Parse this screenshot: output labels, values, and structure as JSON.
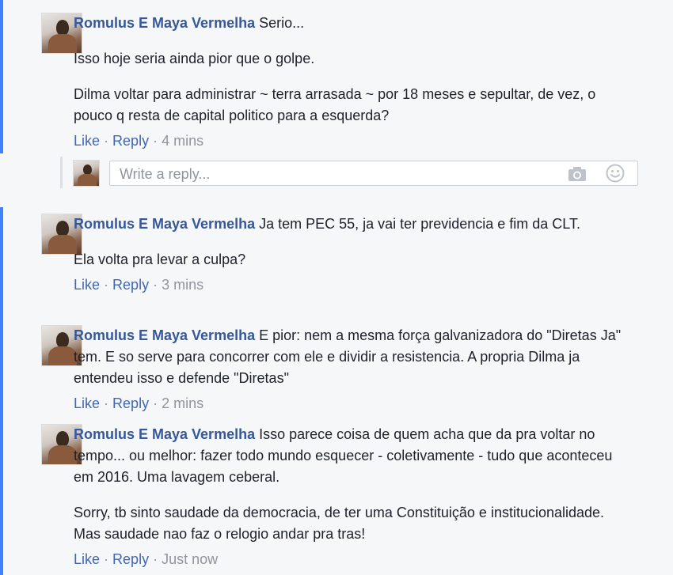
{
  "comments": [
    {
      "author": "Romulus E Maya Vermelha",
      "paragraphs": [
        "Serio...",
        "Isso hoje seria ainda pior que o golpe.",
        "Dilma voltar para administrar ~ terra arrasada ~ por 18 meses e sepultar, de vez, o pouco q resta de capital politico para a esquerda?"
      ],
      "like": "Like",
      "reply": "Reply",
      "time": "4 mins"
    },
    {
      "author": "Romulus E Maya Vermelha",
      "paragraphs": [
        "Ja tem PEC 55, ja vai ter previdencia e fim da CLT.",
        "Ela volta pra levar a culpa?"
      ],
      "like": "Like",
      "reply": "Reply",
      "time": "3 mins"
    },
    {
      "author": "Romulus E Maya Vermelha",
      "paragraphs": [
        "E pior: nem a mesma força galvanizadora do \"Diretas Ja\" tem. E so serve para concorrer com ele e dividir a resistencia. A propria Dilma ja entendeu isso e defende \"Diretas\""
      ],
      "like": "Like",
      "reply": "Reply",
      "time": "2 mins"
    },
    {
      "author": "Romulus E Maya Vermelha",
      "paragraphs": [
        "Isso parece coisa de quem acha que da pra voltar no tempo... ou melhor: fazer todo mundo esquecer - coletivamente - tudo que aconteceu em 2016. Uma lavagem ceberal.",
        "Sorry, tb sinto saudade da democracia, de ter uma Constituição e institucionalidade. Mas saudade nao faz o relogio andar pra tras!"
      ],
      "like": "Like",
      "reply": "Reply",
      "time": "Just now"
    }
  ],
  "reply_box": {
    "placeholder": "Write a reply...",
    "icons": [
      "camera-icon",
      "smiley-icon"
    ]
  },
  "colors": {
    "author": "#365899",
    "link": "#4267b2",
    "meta": "#90949c",
    "thread_bar": "#4080ff"
  }
}
